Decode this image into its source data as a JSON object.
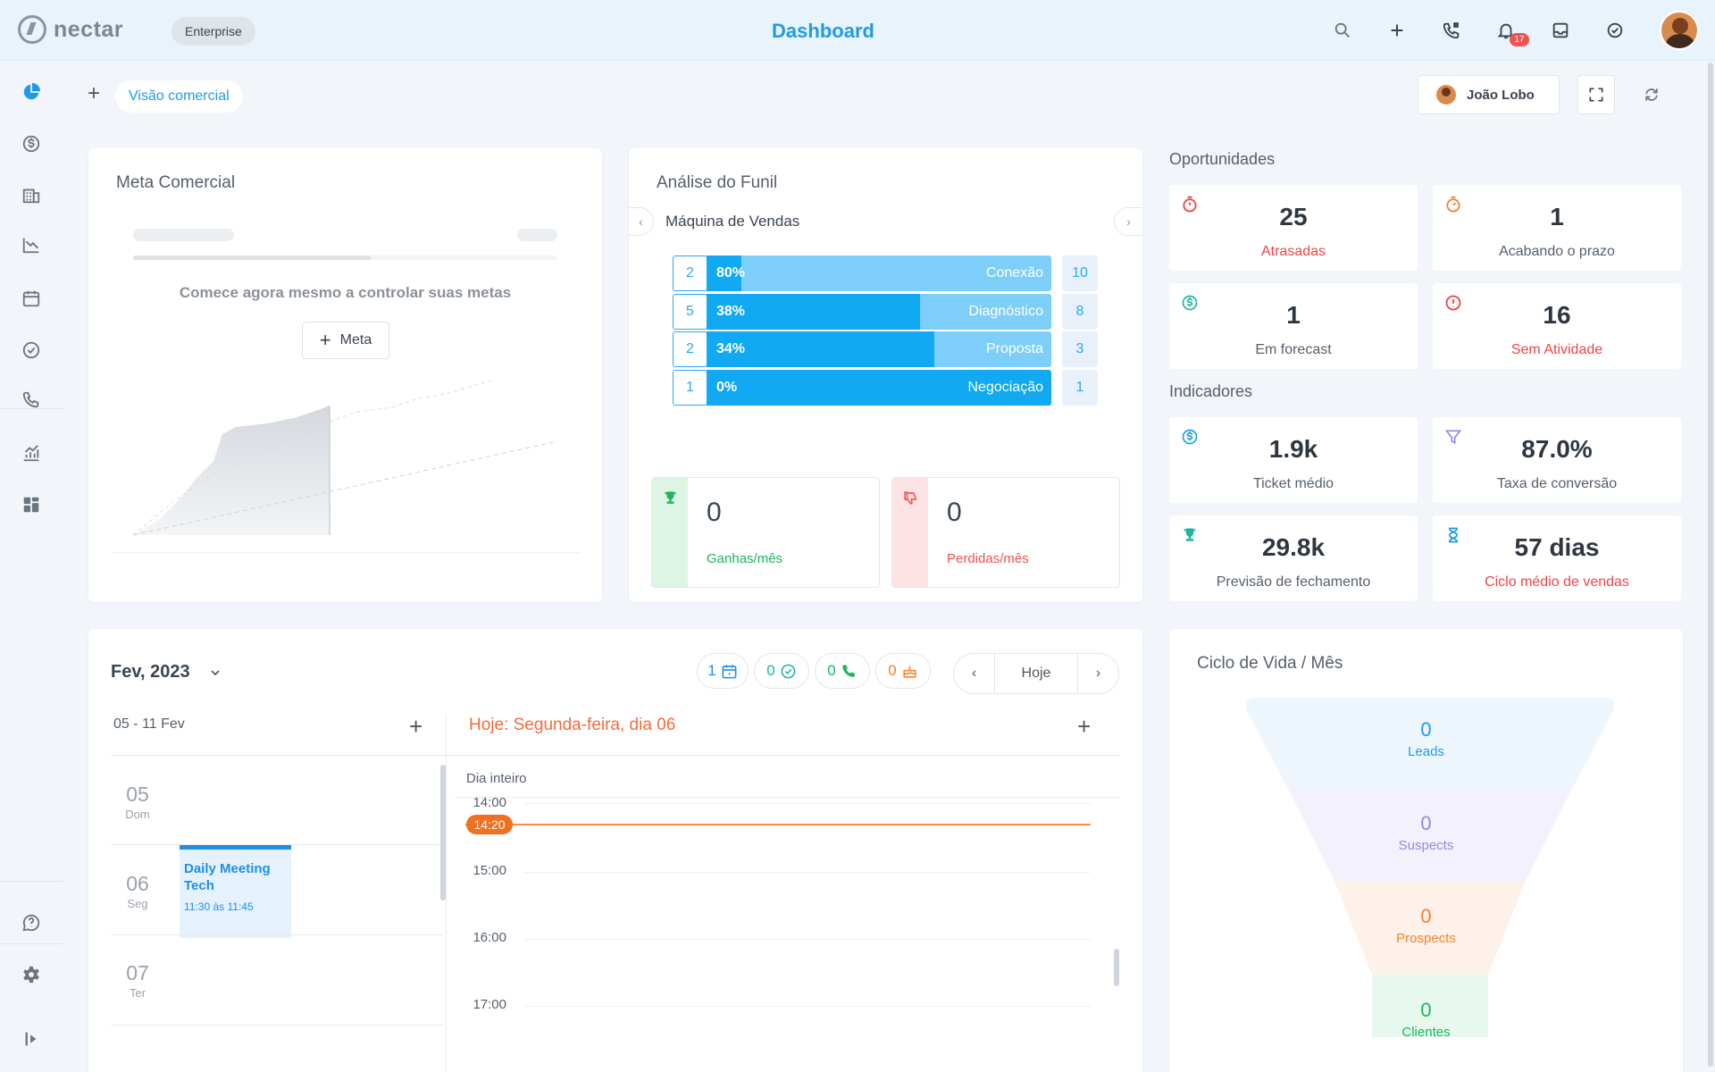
{
  "app": {
    "logo_text": "nectar",
    "plan": "Enterprise",
    "title": "Dashboard"
  },
  "topbar": {
    "notification_count": "17"
  },
  "subheader": {
    "add_view": "+",
    "view_tab": "Visão comercial",
    "user_name": "João Lobo"
  },
  "meta": {
    "title": "Meta Comercial",
    "empty_message": "Comece agora mesmo a controlar suas metas",
    "button_label": "Meta"
  },
  "funil": {
    "title": "Análise do Funil",
    "pipeline": "Máquina de Vendas",
    "stages": [
      {
        "count": "2",
        "percent": "80%",
        "pct_value": 0.1,
        "name": "Conexão",
        "total": "10"
      },
      {
        "count": "5",
        "percent": "38%",
        "pct_value": 0.62,
        "name": "Diagnóstico",
        "total": "8"
      },
      {
        "count": "2",
        "percent": "34%",
        "pct_value": 0.66,
        "name": "Proposta",
        "total": "3"
      },
      {
        "count": "1",
        "percent": "0%",
        "pct_value": 1.0,
        "name": "Negociação",
        "total": "1"
      }
    ],
    "won": {
      "value": "0",
      "label": "Ganhas/mês"
    },
    "lost": {
      "value": "0",
      "label": "Perdidas/mês"
    }
  },
  "oportunidades": {
    "title": "Oportunidades",
    "items": [
      {
        "value": "25",
        "label": "Atrasadas",
        "icon": "alarm-icon"
      },
      {
        "value": "1",
        "label": "Acabando o prazo",
        "icon": "timer-icon"
      },
      {
        "value": "1",
        "label": "Em forecast",
        "icon": "dollar-icon"
      },
      {
        "value": "16",
        "label": "Sem Atividade",
        "icon": "alert-icon"
      }
    ]
  },
  "indicadores": {
    "title": "Indicadores",
    "items": [
      {
        "value": "1.9k",
        "label": "Ticket médio",
        "icon": "dollar-icon"
      },
      {
        "value": "87.0%",
        "label": "Taxa de conversão",
        "icon": "filter-icon"
      },
      {
        "value": "29.8k",
        "label": "Previsão de fechamento",
        "icon": "trophy-icon"
      },
      {
        "value": "57 dias",
        "label": "Ciclo médio de vendas",
        "icon": "hourglass-icon"
      }
    ]
  },
  "calendar": {
    "month": "Fev, 2023",
    "chips": [
      {
        "count": "1",
        "icon": "calendar-icon"
      },
      {
        "count": "0",
        "icon": "check-circle-icon"
      },
      {
        "count": "0",
        "icon": "phone-icon"
      },
      {
        "count": "0",
        "icon": "cake-icon"
      }
    ],
    "today_button": "Hoje",
    "week_range": "05 - 11 Fev",
    "today_label": "Hoje: Segunda-feira, dia 06",
    "days": [
      {
        "num": "05",
        "name": "Dom"
      },
      {
        "num": "06",
        "name": "Seg"
      },
      {
        "num": "07",
        "name": "Ter"
      }
    ],
    "event": {
      "title": "Daily Meeting Tech",
      "time": "11:30 às 11:45"
    },
    "all_day": "Dia inteiro",
    "now": "14:20",
    "hours": [
      "14:00",
      "15:00",
      "16:00",
      "17:00"
    ]
  },
  "ciclo": {
    "title": "Ciclo de Vida / Mês",
    "stages": [
      {
        "value": "0",
        "label": "Leads",
        "color": "#1f9be6"
      },
      {
        "value": "0",
        "label": "Suspects",
        "color": "#9a86e0"
      },
      {
        "value": "0",
        "label": "Prospects",
        "color": "#f5832e"
      },
      {
        "value": "0",
        "label": "Clientes",
        "color": "#1bb55c"
      }
    ]
  }
}
